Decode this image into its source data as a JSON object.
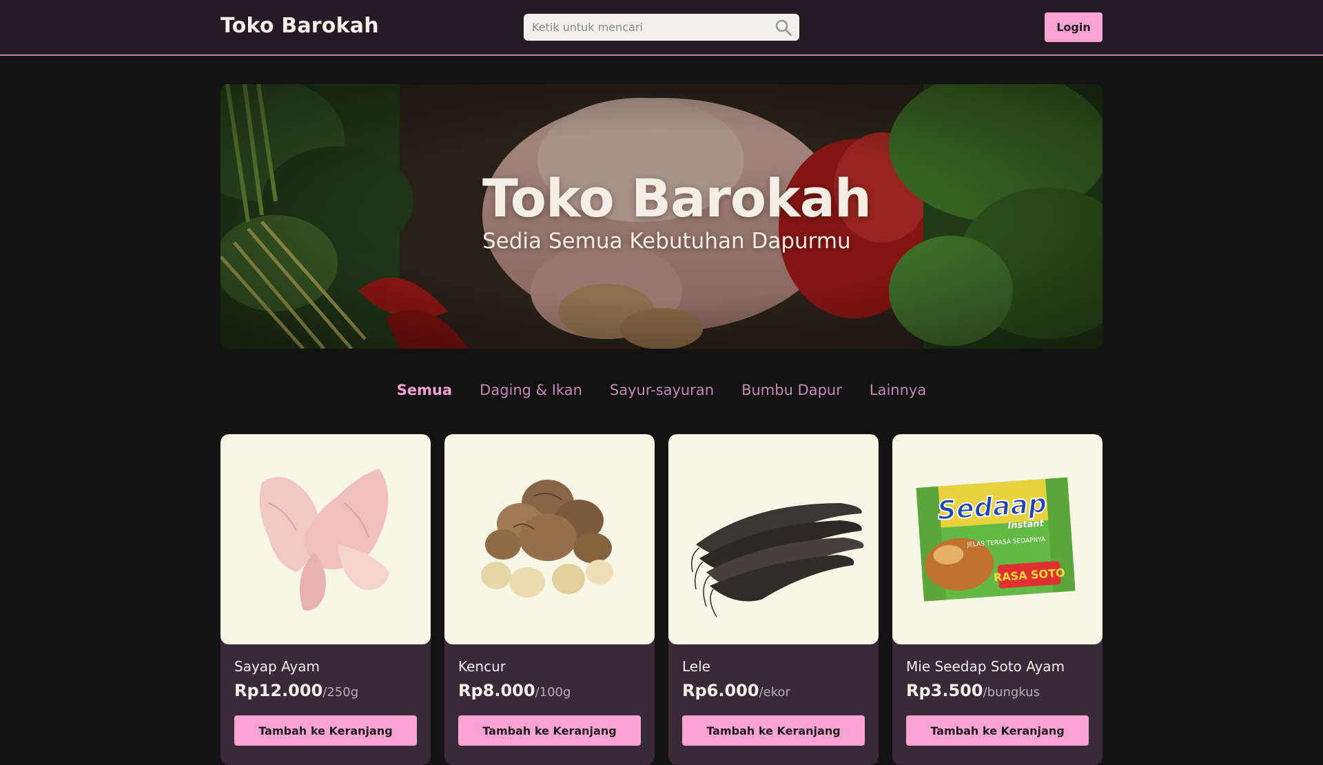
{
  "navbar": {
    "brand": "Toko Barokah",
    "search_placeholder": "Ketik untuk mencari",
    "login_label": "Login",
    "search_icon": "search-icon"
  },
  "hero": {
    "title": "Toko Barokah",
    "subtitle": "Sedia Semua Kebutuhan Dapurmu"
  },
  "categories": [
    {
      "label": "Semua",
      "active": true
    },
    {
      "label": "Daging & Ikan",
      "active": false
    },
    {
      "label": "Sayur-sayuran",
      "active": false
    },
    {
      "label": "Bumbu Dapur",
      "active": false
    },
    {
      "label": "Lainnya",
      "active": false
    }
  ],
  "products": [
    {
      "name": "Sayap Ayam",
      "price": "Rp12.000",
      "unit": "/250g",
      "button": "Tambah ke Keranjang"
    },
    {
      "name": "Kencur",
      "price": "Rp8.000",
      "unit": "/100g",
      "button": "Tambah ke Keranjang"
    },
    {
      "name": "Lele",
      "price": "Rp6.000",
      "unit": "/ekor",
      "button": "Tambah ke Keranjang"
    },
    {
      "name": "Mie Seedap Soto Ayam",
      "price": "Rp3.500",
      "unit": "/bungkus",
      "button": "Tambah ke Keranjang"
    }
  ],
  "package_text": {
    "brand": "Sedaap",
    "sub": "Instant",
    "tagline": "JELAS TERASA SEDAPNYA",
    "flavor": "RASA SOTO"
  },
  "colors": {
    "accent": "#fba3d5",
    "navbar_bg": "#241c24",
    "page_bg": "#131313",
    "card_bg": "#392939",
    "card_image_bg": "#f8f6e6",
    "tab_color": "#c689b2"
  }
}
